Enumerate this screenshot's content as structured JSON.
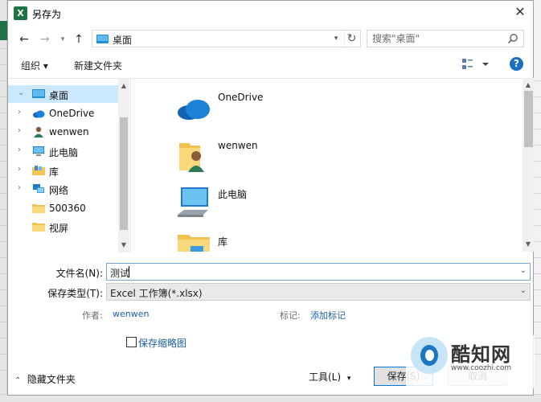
{
  "window": {
    "title": "另存为",
    "app_icon_letter": "X"
  },
  "address": {
    "path": "桌面",
    "search_placeholder": "搜索\"桌面\""
  },
  "toolbar": {
    "organize": "组织 ▾",
    "new_folder": "新建文件夹",
    "help": "?"
  },
  "nav": {
    "items": [
      {
        "label": "桌面",
        "icon": "desktop-icon",
        "expanded": true
      },
      {
        "label": "OneDrive",
        "icon": "onedrive-icon"
      },
      {
        "label": "wenwen",
        "icon": "user-icon"
      },
      {
        "label": "此电脑",
        "icon": "computer-icon"
      },
      {
        "label": "库",
        "icon": "library-icon"
      },
      {
        "label": "网络",
        "icon": "network-icon"
      },
      {
        "label": "500360",
        "icon": "folder-icon"
      },
      {
        "label": "视屏",
        "icon": "folder-icon"
      }
    ]
  },
  "content": {
    "items": [
      {
        "label": "OneDrive",
        "icon": "onedrive-icon"
      },
      {
        "label": "wenwen",
        "icon": "user-folder-icon"
      },
      {
        "label": "此电脑",
        "icon": "computer-icon"
      },
      {
        "label": "库",
        "icon": "library-icon"
      }
    ]
  },
  "form": {
    "filename_label": "文件名(N):",
    "filename_value": "测试",
    "filetype_label": "保存类型(T):",
    "filetype_value": "Excel 工作簿(*.xlsx)",
    "author_label": "作者:",
    "author_value": "wenwen",
    "tags_label": "标记:",
    "tags_value": "添加标记",
    "thumbnail_label": "保存缩略图"
  },
  "footer": {
    "hide_folders": "隐藏文件夹",
    "tools": "工具(L)",
    "save": "保存(S)",
    "cancel": "取消"
  },
  "watermark": {
    "title": "酷知网",
    "url": "www.coozhi.com"
  },
  "colors": {
    "selection": "#cce8ff",
    "link": "#1a5fa5",
    "accent": "#1b6ec2",
    "excel_green": "#1f7244"
  }
}
